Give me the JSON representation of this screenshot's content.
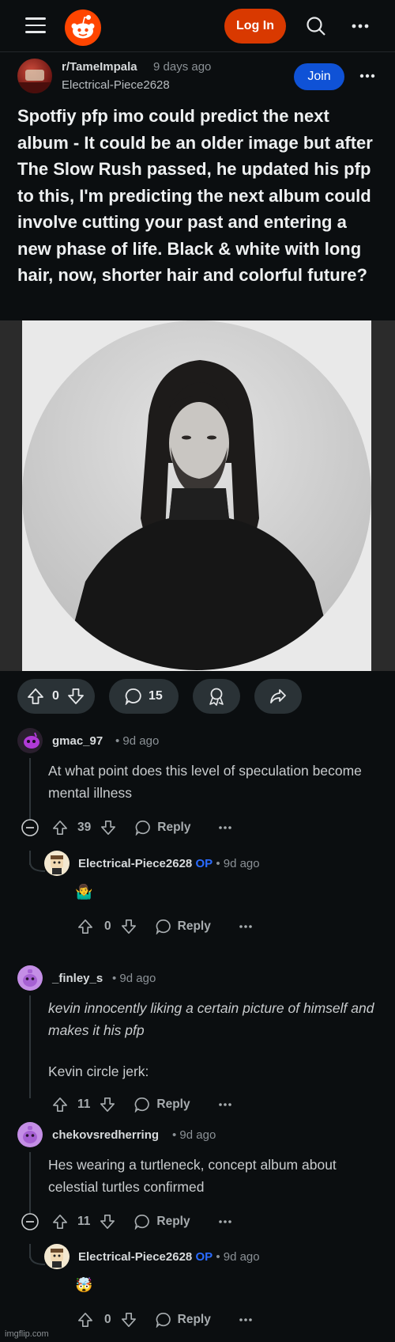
{
  "header": {
    "login_label": "Log In"
  },
  "post": {
    "subreddit": "r/TameImpala",
    "time": "9 days ago",
    "author": "Electrical-Piece2628",
    "join_label": "Join",
    "title": "Spotfiy pfp imo could predict the next album - It could be an older image but after The Slow Rush passed, he updated his pfp to this, I'm predicting the next album could involve cutting your past and entering a new phase of life. Black & white with long hair, now, shorter hair and colorful future?",
    "score": "0",
    "comments": "15"
  },
  "comments": [
    {
      "user": "gmac_97",
      "time": "• 9d ago",
      "body": "At what point does this level of speculation become mental illness",
      "score": "39",
      "reply_label": "Reply"
    },
    {
      "user": "Electrical-Piece2628",
      "op": "OP",
      "time": "• 9d ago",
      "emoji": "🤷‍♂️",
      "score": "0",
      "reply_label": "Reply"
    },
    {
      "user": "_finley_s",
      "time": "• 9d ago",
      "body_italic": "kevin innocently liking a certain picture of himself and makes it his pfp",
      "body2": "Kevin circle jerk:",
      "score": "11",
      "reply_label": "Reply"
    },
    {
      "user": "chekovsredherring",
      "time": "• 9d ago",
      "body": "Hes wearing a turtleneck, concept album about celestial turtles confirmed",
      "score": "11",
      "reply_label": "Reply"
    },
    {
      "user": "Electrical-Piece2628",
      "op": "OP",
      "time": "• 9d ago",
      "emoji": "🤯",
      "score": "0",
      "reply_label": "Reply"
    }
  ],
  "watermark": "imgflip.com"
}
